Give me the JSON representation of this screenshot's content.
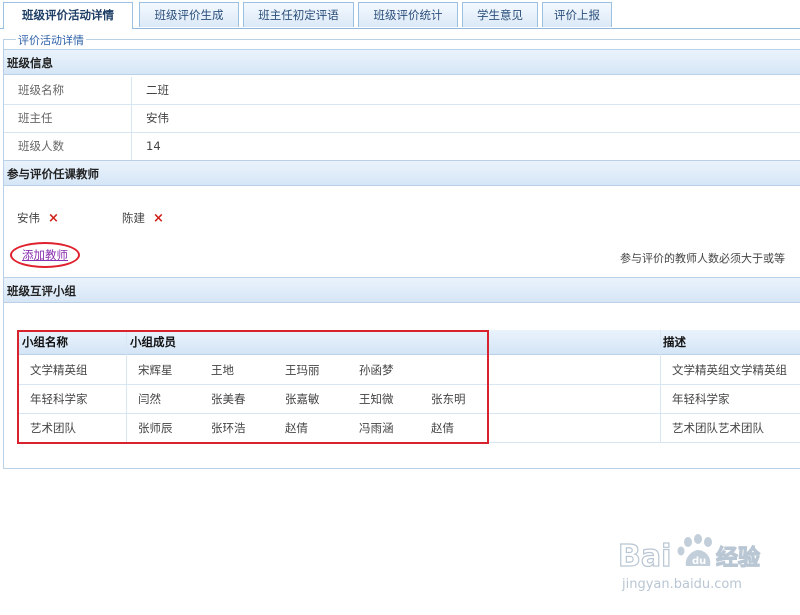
{
  "tabs": [
    {
      "label": "班级评价活动详情",
      "active": true
    },
    {
      "label": "班级评价生成",
      "active": false
    },
    {
      "label": "班主任初定评语",
      "active": false
    },
    {
      "label": "班级评价统计",
      "active": false
    },
    {
      "label": "学生意见",
      "active": false
    },
    {
      "label": "评价上报",
      "active": false
    }
  ],
  "fieldset_legend": "评价活动详情",
  "class_info": {
    "title": "班级信息",
    "rows": [
      {
        "label": "班级名称",
        "value": "二班"
      },
      {
        "label": "班主任",
        "value": "安伟"
      },
      {
        "label": "班级人数",
        "value": "14"
      }
    ]
  },
  "teachers": {
    "title": "参与评价任课教师",
    "list": [
      "安伟",
      "陈建"
    ],
    "remove_icon": "×",
    "add_label": "添加教师",
    "note": "参与评价的教师人数必须大于或等"
  },
  "groups": {
    "title": "班级互评小组",
    "headers": {
      "name": "小组名称",
      "members": "小组成员",
      "desc": "描述"
    },
    "rows": [
      {
        "name": "文学精英组",
        "members": [
          "宋辉星",
          "王地",
          "王玛丽",
          "孙函梦",
          ""
        ],
        "desc": "文学精英组文学精英组"
      },
      {
        "name": "年轻科学家",
        "members": [
          "闫然",
          "张美春",
          "张嘉敏",
          "王知微",
          "张东明"
        ],
        "desc": "年轻科学家"
      },
      {
        "name": "艺术团队",
        "members": [
          "张师辰",
          "张环浩",
          "赵倩",
          "冯雨涵",
          "赵倩"
        ],
        "desc": "艺术团队艺术团队"
      }
    ]
  },
  "watermark": {
    "brand": "Bai",
    "brand2": "经验",
    "url": "jingyan.baidu.com",
    "color": "#b9c6d3"
  }
}
